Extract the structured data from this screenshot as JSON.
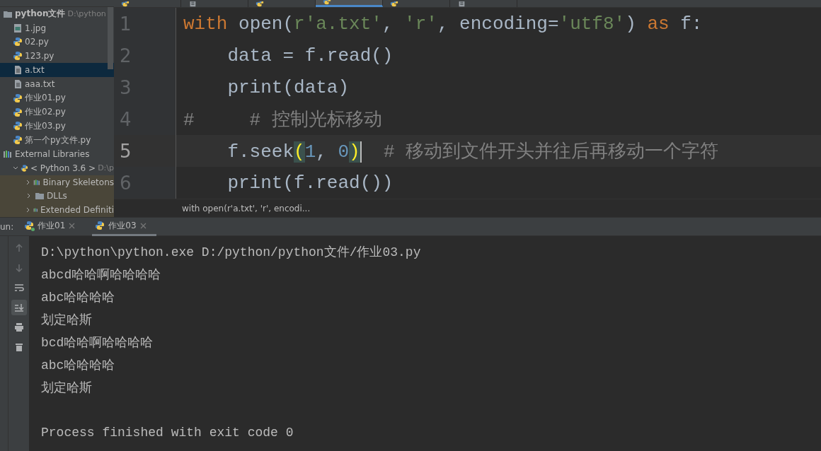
{
  "project_tree": [
    {
      "label": "python文件",
      "hint": "D:\\python",
      "kind": "folder",
      "expanded": true,
      "selected": false,
      "children": [
        {
          "label": "1.jpg",
          "kind": "image",
          "selected": false
        },
        {
          "label": "02.py",
          "kind": "python",
          "selected": false
        },
        {
          "label": "123.py",
          "kind": "python",
          "selected": false
        },
        {
          "label": "a.txt",
          "kind": "text",
          "selected": true
        },
        {
          "label": "aaa.txt",
          "kind": "text",
          "selected": false
        },
        {
          "label": "作业01.py",
          "kind": "python",
          "selected": false
        },
        {
          "label": "作业02.py",
          "kind": "python",
          "selected": false
        },
        {
          "label": "作业03.py",
          "kind": "python",
          "selected": false
        },
        {
          "label": "第一个py文件.py",
          "kind": "python",
          "selected": false
        }
      ]
    },
    {
      "label": "External Libraries",
      "kind": "library",
      "expanded": true,
      "selected": false,
      "children": [
        {
          "label": "< Python 3.6 >",
          "hint": "D:\\p",
          "kind": "python",
          "expanded": true,
          "selected": false,
          "children": [
            {
              "label": "Binary Skeletons",
              "kind": "library",
              "expanded": false,
              "selected": false
            },
            {
              "label": "DLLs",
              "kind": "folder",
              "expanded": false,
              "selected": false
            },
            {
              "label": "Extended Definiti",
              "kind": "library",
              "expanded": false,
              "selected": false
            }
          ]
        }
      ]
    }
  ],
  "editor_tabs": [
    {
      "kind": "python",
      "selected": false
    },
    {
      "kind": "text",
      "selected": false
    },
    {
      "kind": "python",
      "selected": false
    },
    {
      "kind": "python",
      "selected": true
    },
    {
      "kind": "python",
      "selected": false
    },
    {
      "kind": "text",
      "selected": false
    }
  ],
  "code_lines": [
    {
      "number": "1",
      "current": false,
      "tokens": [
        {
          "kind": "keyword",
          "text": "with"
        },
        {
          "kind": "plain",
          "text": " open("
        },
        {
          "kind": "string",
          "text": "r'a.txt'"
        },
        {
          "kind": "plain",
          "text": ", "
        },
        {
          "kind": "string",
          "text": "'r'"
        },
        {
          "kind": "plain",
          "text": ", encoding="
        },
        {
          "kind": "string",
          "text": "'utf8'"
        },
        {
          "kind": "plain",
          "text": ") "
        },
        {
          "kind": "keyword",
          "text": "as"
        },
        {
          "kind": "plain",
          "text": " f:"
        }
      ]
    },
    {
      "number": "2",
      "current": false,
      "tokens": [
        {
          "kind": "plain",
          "text": "    data = f.read()"
        }
      ]
    },
    {
      "number": "3",
      "current": false,
      "tokens": [
        {
          "kind": "plain",
          "text": "    print(data)"
        }
      ]
    },
    {
      "number": "4",
      "current": false,
      "tokens": [
        {
          "kind": "comment",
          "text": "#     # 控制光标移动"
        }
      ]
    },
    {
      "number": "5",
      "current": true,
      "tokens": [
        {
          "kind": "plain",
          "text": "    f.seek"
        },
        {
          "kind": "brace",
          "text": "("
        },
        {
          "kind": "number",
          "text": "1"
        },
        {
          "kind": "plain",
          "text": ", "
        },
        {
          "kind": "number",
          "text": "0"
        },
        {
          "kind": "brace",
          "text": ")"
        },
        {
          "kind": "cursor"
        },
        {
          "kind": "comment",
          "text": "  # 移动到文件开头并往后再移动一个字符"
        }
      ]
    },
    {
      "number": "6",
      "current": false,
      "tokens": [
        {
          "kind": "plain",
          "text": "    print(f.read())"
        }
      ]
    }
  ],
  "breadcrumb": "with open(r'a.txt', 'r', encodi...",
  "run_panel": {
    "label": "un:",
    "tabs": [
      {
        "label": "作业01",
        "selected": false,
        "running": true
      },
      {
        "label": "作业03",
        "selected": true,
        "running": false
      }
    ],
    "tools": [
      {
        "kind": "up",
        "selected": false
      },
      {
        "kind": "down",
        "selected": false
      },
      {
        "kind": "wrap",
        "selected": false
      },
      {
        "kind": "scroll-end",
        "selected": true
      },
      {
        "kind": "print",
        "selected": false
      },
      {
        "kind": "trash",
        "selected": false
      }
    ],
    "output": [
      {
        "kind": "text",
        "text": "D:\\python\\python.exe D:/python/python文件/作业03.py"
      },
      {
        "kind": "text",
        "text": "abcd哈哈啊哈哈哈哈"
      },
      {
        "kind": "text",
        "text": "abc哈哈哈哈"
      },
      {
        "kind": "text",
        "text": "划定哈斯"
      },
      {
        "kind": "text",
        "text": "bcd哈哈啊哈哈哈哈"
      },
      {
        "kind": "text",
        "text": "abc哈哈哈哈"
      },
      {
        "kind": "text",
        "text": "划定哈斯"
      },
      {
        "kind": "blank"
      },
      {
        "kind": "text",
        "text": "Process finished with exit code 0"
      }
    ]
  }
}
